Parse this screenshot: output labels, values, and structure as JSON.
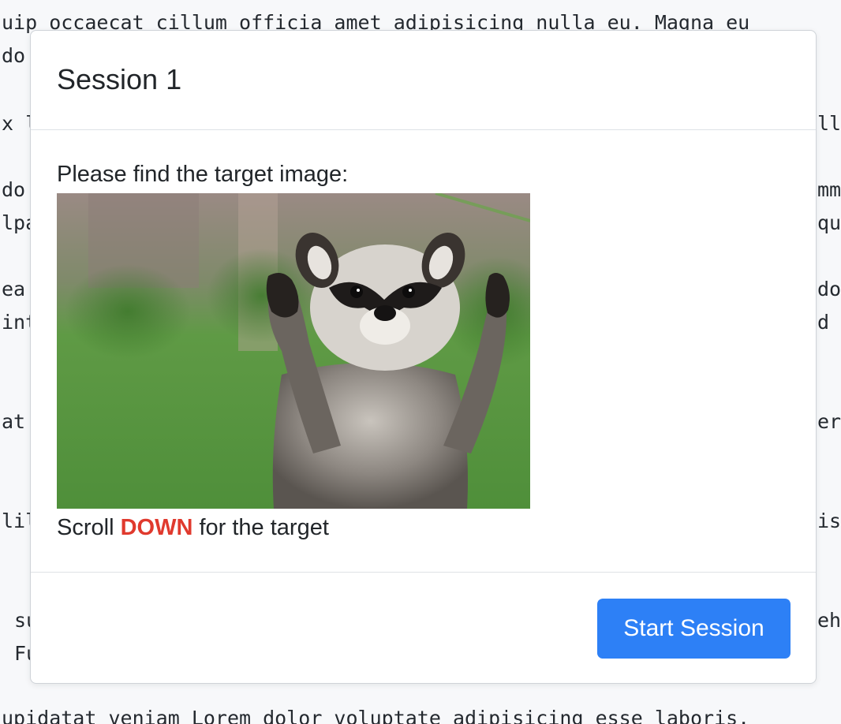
{
  "background_text": {
    "line1": "uip occaecat cillum officia amet adipisicing nulla eu. Magna eu",
    "line2": "do",
    "line3_left": "x l",
    "line3_right": "ll",
    "line4_left": "do",
    "line4_right": "mme",
    "line5_left": "lpa",
    "line5_right": "qu",
    "line6_left": "ea",
    "line6_right": "do",
    "line7_left": "int",
    "line7_right": "d c",
    "line8_left": "at",
    "line8_right": "er",
    "line9_left": "lil",
    "line9_right": "is",
    "line10_left": "su",
    "line10_right": "ehe",
    "line11_left": "Fu",
    "line12": "upidatat veniam Lorem dolor voluptate adipisicing esse laboris."
  },
  "modal": {
    "title": "Session 1",
    "prompt": "Please find the target image:",
    "image_alt": "raccoon standing with raised paws",
    "hint_prefix": "Scroll ",
    "hint_emphasis": "DOWN",
    "hint_suffix": " for the target",
    "button_label": "Start Session"
  },
  "colors": {
    "accent": "#2d80f6",
    "emphasis": "#e03a2e"
  }
}
